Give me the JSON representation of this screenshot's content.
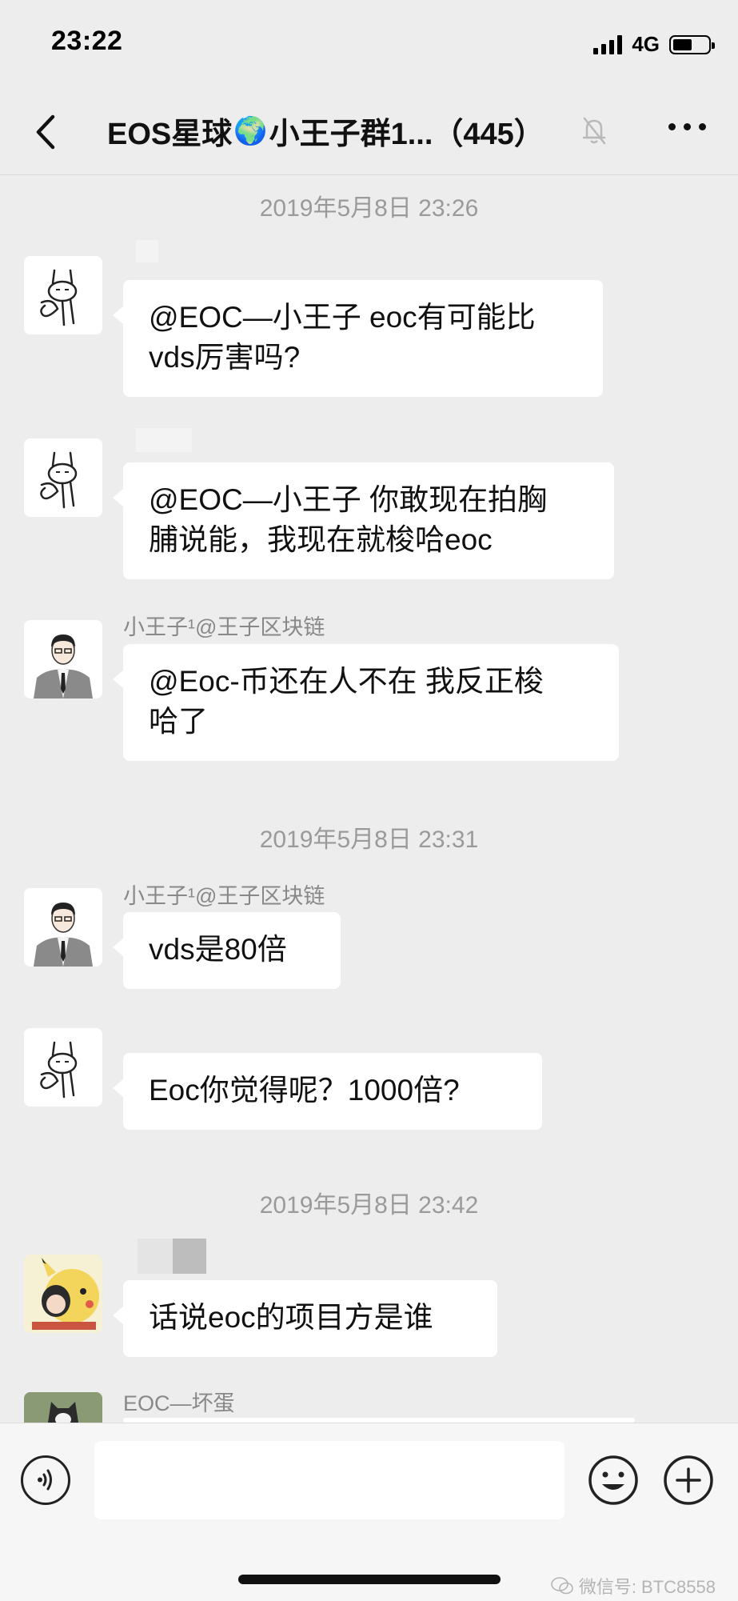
{
  "status_bar": {
    "time": "23:22",
    "network": "4G",
    "battery_level": 0.55
  },
  "nav": {
    "title_prefix": "EOS星球",
    "title_emoji": "🌍",
    "title_suffix": "小王子群1...（445）"
  },
  "messages": [
    {
      "kind": "timestamp",
      "text": "2019年5月8日 23:26"
    },
    {
      "kind": "message",
      "sender": "",
      "text_lines": [
        "@EOC—小王子 eoc有可能比",
        "vds厉害吗?"
      ]
    },
    {
      "kind": "message",
      "sender": "",
      "text_lines": [
        "@EOC—小王子 你敢现在拍胸",
        "脯说能，我现在就梭哈eoc"
      ]
    },
    {
      "kind": "message",
      "sender": "小王子¹@王子区块链",
      "text_lines": [
        "@Eoc-币还在人不在 我反正梭",
        "哈了"
      ]
    },
    {
      "kind": "timestamp",
      "text": "2019年5月8日 23:31"
    },
    {
      "kind": "message",
      "sender": "小王子¹@王子区块链",
      "text_lines": [
        "vds是80倍"
      ]
    },
    {
      "kind": "message",
      "sender": "",
      "text_lines": [
        "Eoc你觉得呢？1000倍?"
      ]
    },
    {
      "kind": "timestamp",
      "text": "2019年5月8日 23:42"
    },
    {
      "kind": "message",
      "sender": "",
      "text_lines": [
        "话说eoc的项目方是谁"
      ]
    },
    {
      "kind": "message",
      "sender": "EOC—坏蛋",
      "text_lines": []
    }
  ],
  "input": {
    "placeholder": ""
  },
  "watermark": "微信号: BTC8558",
  "icons": {
    "back": "chevron-left-icon",
    "mute": "bell-off-icon",
    "more": "more-dots-icon",
    "voice": "voice-icon",
    "emoji": "emoji-icon",
    "plus": "plus-icon"
  }
}
